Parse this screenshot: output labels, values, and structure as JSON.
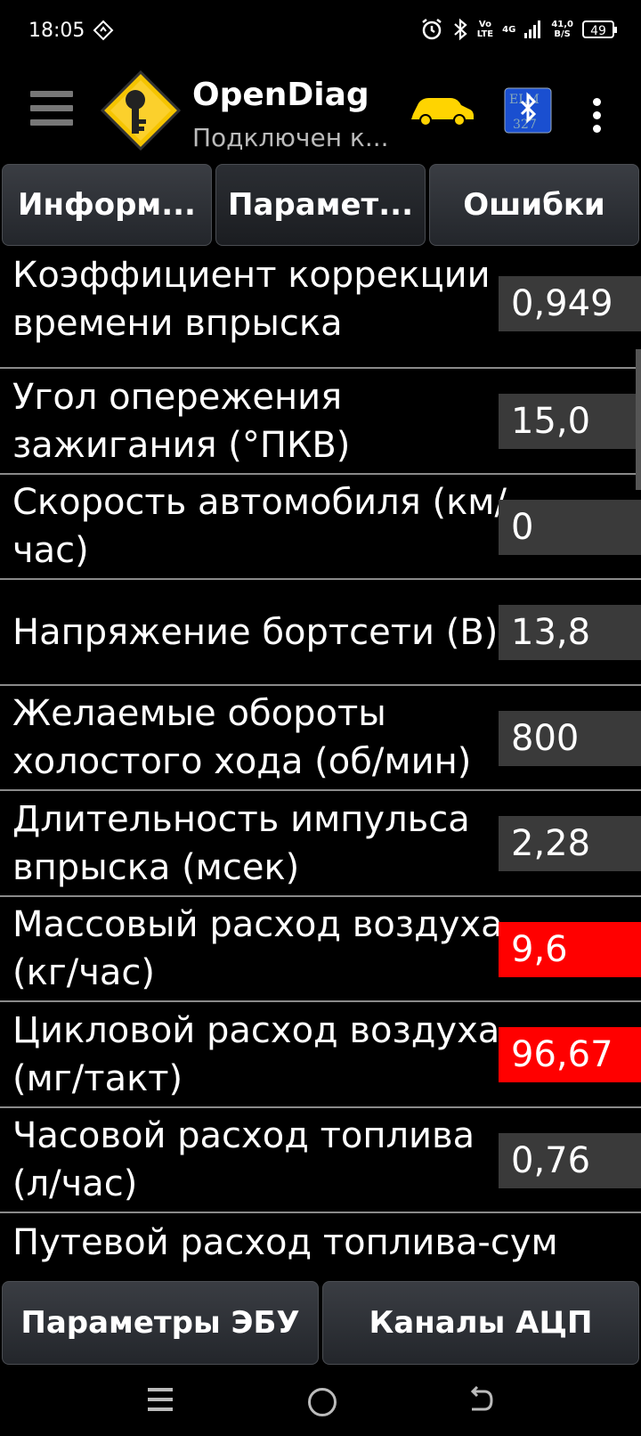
{
  "status_bar": {
    "time": "18:05",
    "network_vo": "Vo",
    "network_lte": "LTE",
    "network_4g": "4G",
    "speed_value": "41,0",
    "speed_unit": "B/S",
    "battery": "49",
    "icons": [
      "location-icon",
      "alarm-icon",
      "bluetooth-icon",
      "signal-icon"
    ]
  },
  "app_bar": {
    "title": "OpenDiag",
    "subtitle": "Подключен к...",
    "icons": [
      "menu-icon",
      "key-logo-icon",
      "car-icon",
      "bluetooth-elm-icon",
      "more-icon"
    ],
    "car_color": "#ffd400"
  },
  "tabs": [
    {
      "label": "Информ..."
    },
    {
      "label": "Парамет..."
    },
    {
      "label": "Ошибки"
    }
  ],
  "parameters": [
    {
      "label": "Коэффициент коррекции времени впрыска",
      "value": "0,949",
      "alert": false
    },
    {
      "label": "Угол опережения зажигания (°ПКВ)",
      "value": "15,0",
      "alert": false
    },
    {
      "label": "Скорость автомобиля (км/час)",
      "value": "0",
      "alert": false
    },
    {
      "label": "Напряжение бортсети (В)",
      "value": "13,8",
      "alert": false
    },
    {
      "label": "Желаемые обороты холостого хода (об/мин)",
      "value": "800",
      "alert": false
    },
    {
      "label": "Длительность импульса впрыска (мсек)",
      "value": "2,28",
      "alert": false
    },
    {
      "label": "Массовый расход воздуха (кг/час)",
      "value": "9,6",
      "alert": true
    },
    {
      "label": "Цикловой расход воздуха (мг/такт)",
      "value": "96,67",
      "alert": true
    },
    {
      "label": "Часовой расход топлива (л/час)",
      "value": "0,76",
      "alert": false
    },
    {
      "label": "Путевой расход топлива-сум",
      "value": "",
      "alert": false
    }
  ],
  "bottom_buttons": {
    "ecu_params": "Параметры ЭБУ",
    "adc_channels": "Каналы АЦП"
  },
  "colors": {
    "alert": "#ff0000",
    "value_bg": "#3a3a3a",
    "logo_yellow": "#f5c400"
  }
}
